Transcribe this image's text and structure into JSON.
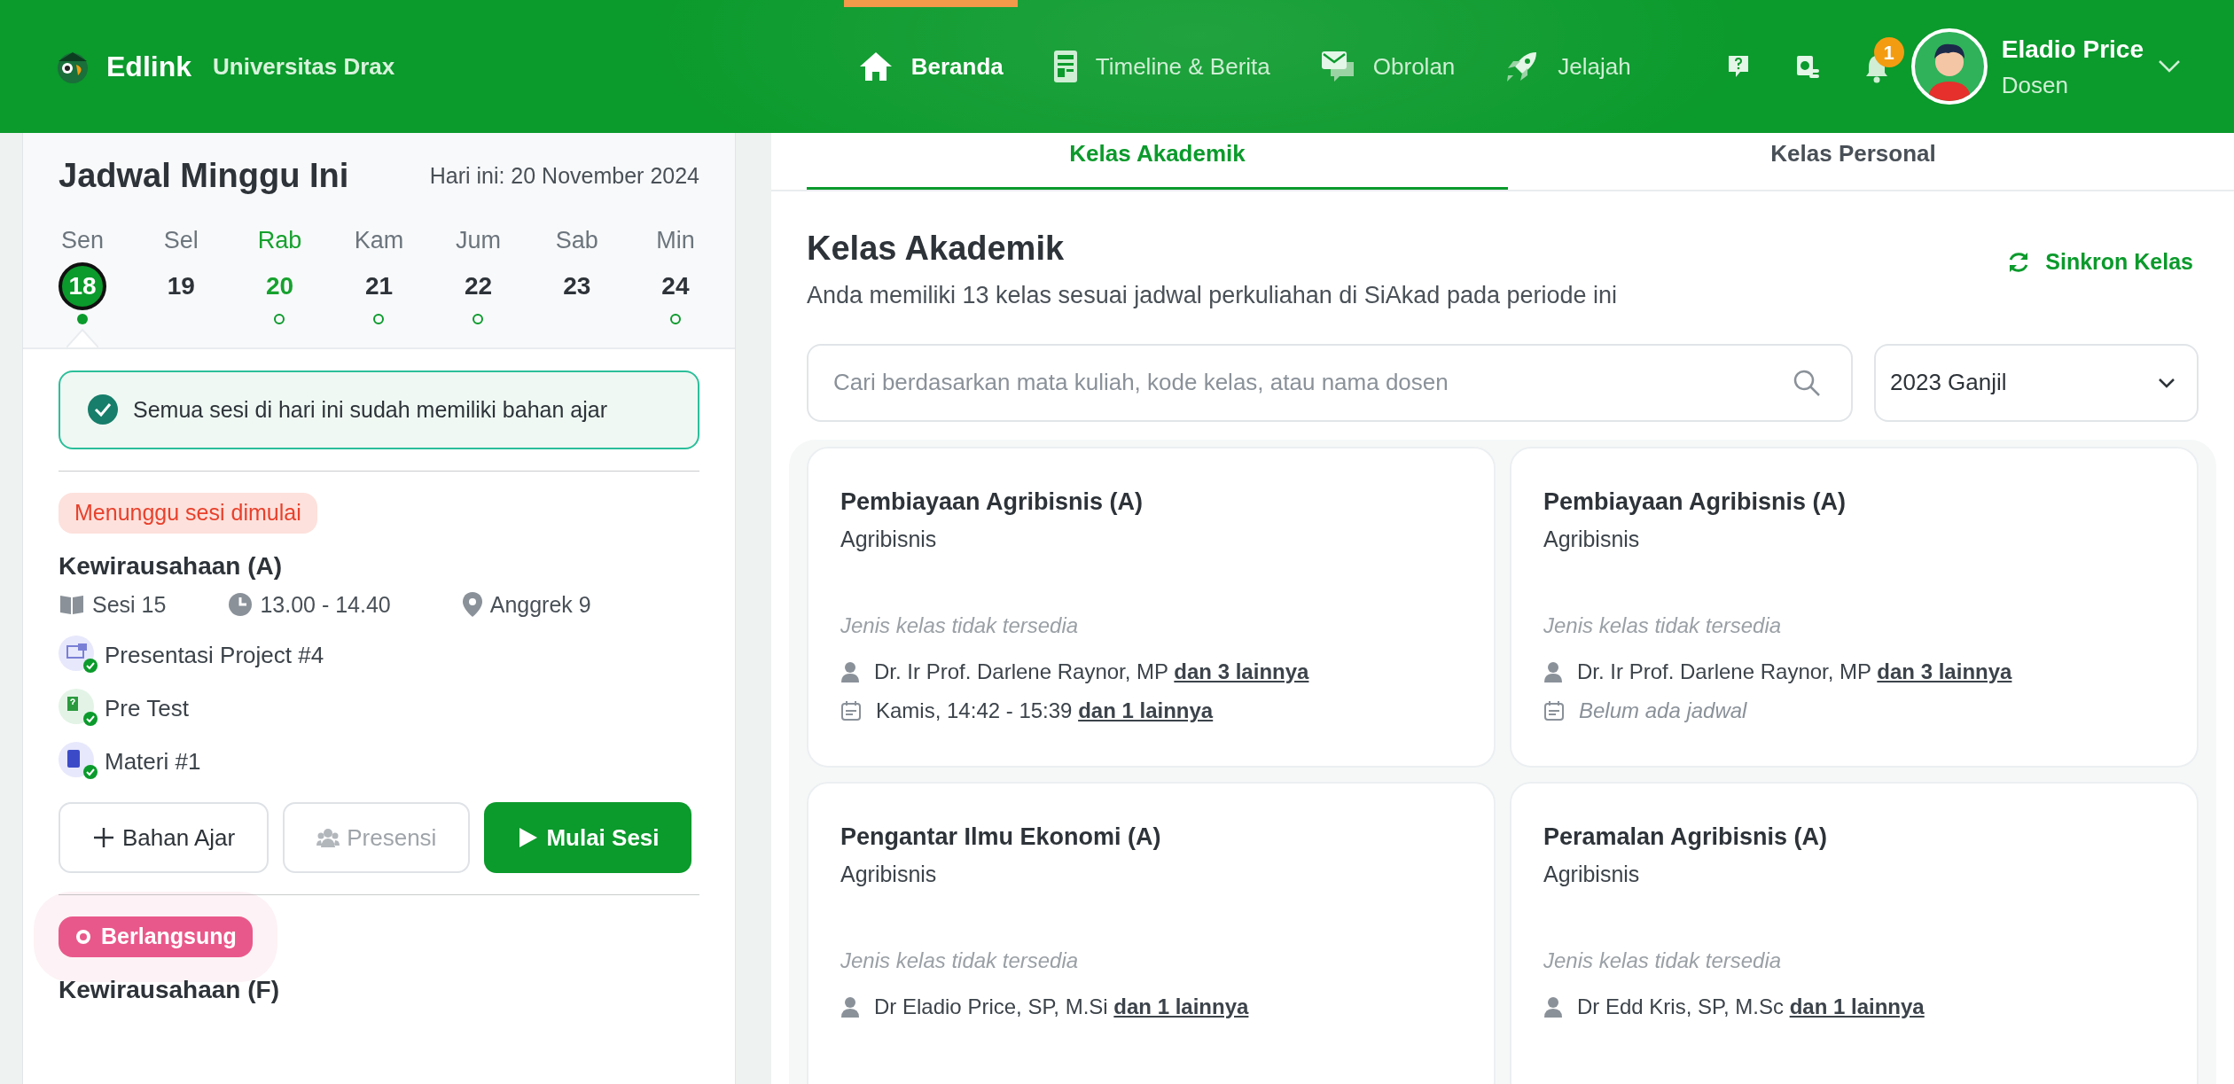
{
  "navbar": {
    "brand": "Edlink",
    "university": "Universitas Drax",
    "links": [
      {
        "label": "Beranda",
        "kind": "home",
        "selected": true
      },
      {
        "label": "Timeline & Berita",
        "kind": "news",
        "selected": false
      },
      {
        "label": "Obrolan",
        "kind": "chat",
        "selected": false
      },
      {
        "label": "Jelajah",
        "kind": "explore",
        "selected": false
      }
    ],
    "notification_count": "1",
    "user": {
      "name": "Eladio Price",
      "role": "Dosen"
    }
  },
  "schedule": {
    "title": "Jadwal Minggu Ini",
    "today": "Hari ini: 20 November 2024",
    "days": [
      {
        "day": "Sen",
        "date": "18",
        "selected": true,
        "today": false,
        "has_sessions": true
      },
      {
        "day": "Sel",
        "date": "19",
        "selected": false,
        "today": false,
        "has_sessions": false
      },
      {
        "day": "Rab",
        "date": "20",
        "selected": false,
        "today": true,
        "has_sessions": true
      },
      {
        "day": "Kam",
        "date": "21",
        "selected": false,
        "today": false,
        "has_sessions": true
      },
      {
        "day": "Jum",
        "date": "22",
        "selected": false,
        "today": false,
        "has_sessions": true
      },
      {
        "day": "Sab",
        "date": "23",
        "selected": false,
        "today": false,
        "has_sessions": false
      },
      {
        "day": "Min",
        "date": "24",
        "selected": false,
        "today": false,
        "has_sessions": true
      }
    ],
    "notice": "Semua sesi di hari ini sudah memiliki bahan ajar",
    "sessions": [
      {
        "status": "Menunggu sesi dimulai",
        "kind": "waiting",
        "title": "Kewirausahaan (A)",
        "session": "Sesi 15",
        "time": "13.00 - 14.40",
        "room": "Anggrek 9",
        "materials": [
          {
            "kind": "presentation",
            "label": "Presentasi Project #4",
            "done": true
          },
          {
            "kind": "test",
            "label": "Pre Test",
            "done": true
          },
          {
            "kind": "material",
            "label": "Materi #1",
            "done": true
          }
        ],
        "buttons": [
          {
            "kind": "add",
            "label": "Bahan Ajar",
            "disabled": false
          },
          {
            "kind": "attendance",
            "label": "Presensi",
            "disabled": true
          },
          {
            "kind": "start",
            "label": "Mulai Sesi",
            "disabled": false
          }
        ]
      },
      {
        "status": "Berlangsung",
        "kind": "live",
        "title": "Kewirausahaan (F)"
      }
    ]
  },
  "classes": {
    "tabs": [
      {
        "label": "Kelas Akademik",
        "selected": true
      },
      {
        "label": "Kelas Personal",
        "selected": false
      }
    ],
    "title": "Kelas Akademik",
    "subtitle": "Anda memiliki 13 kelas sesuai jadwal perkuliahan di SiAkad pada periode ini",
    "sync_button": "Sinkron Kelas",
    "search": {
      "placeholder": "Cari berdasarkan mata kuliah, kode kelas, atau nama dosen"
    },
    "period": "2023 Ganjil",
    "cards": [
      {
        "title": "Pembiayaan Agribisnis (A)",
        "department": "Agribisnis",
        "type": "Jenis kelas tidak tersedia",
        "lecturer": "Dr. Ir Prof. Darlene Raynor, MP",
        "lecturer_more": "dan 3 lainnya",
        "schedule": "Kamis, 14:42 - 15:39",
        "schedule_more": "dan 1 lainnya",
        "has_schedule": true
      },
      {
        "title": "Pembiayaan Agribisnis (A)",
        "department": "Agribisnis",
        "type": "Jenis kelas tidak tersedia",
        "lecturer": "Dr. Ir Prof. Darlene Raynor, MP",
        "lecturer_more": "dan 3 lainnya",
        "schedule": "Belum ada jadwal",
        "has_schedule": false
      },
      {
        "title": "Pengantar Ilmu Ekonomi (A)",
        "department": "Agribisnis",
        "type": "Jenis kelas tidak tersedia",
        "lecturer": "Dr Eladio Price, SP, M.Si",
        "lecturer_more": "dan 1 lainnya"
      },
      {
        "title": "Peramalan Agribisnis (A)",
        "department": "Agribisnis",
        "type": "Jenis kelas tidak tersedia",
        "lecturer": "Dr Edd Kris, SP, M.Sc",
        "lecturer_more": "dan 1 lainnya"
      }
    ]
  }
}
